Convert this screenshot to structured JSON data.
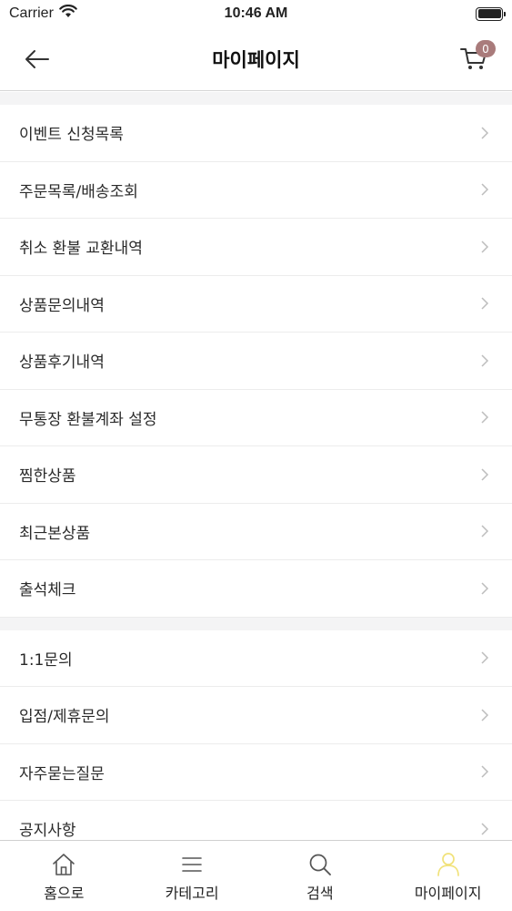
{
  "status_bar": {
    "carrier": "Carrier",
    "time": "10:46 AM"
  },
  "header": {
    "title": "마이페이지",
    "cart_count": "0"
  },
  "menu_sections": [
    {
      "items": [
        {
          "label": "이벤트 신청목록"
        },
        {
          "label": "주문목록/배송조회"
        },
        {
          "label": "취소 환불 교환내역"
        },
        {
          "label": "상품문의내역"
        },
        {
          "label": "상품후기내역"
        },
        {
          "label": "무통장 환불계좌 설정"
        },
        {
          "label": "찜한상품"
        },
        {
          "label": "최근본상품"
        },
        {
          "label": "출석체크"
        }
      ]
    },
    {
      "items": [
        {
          "label": "1:1문의"
        },
        {
          "label": "입점/제휴문의"
        },
        {
          "label": "자주묻는질문"
        },
        {
          "label": "공지사항"
        }
      ]
    }
  ],
  "tab_bar": {
    "tabs": [
      {
        "label": "홈으로",
        "icon": "home-icon"
      },
      {
        "label": "카테고리",
        "icon": "menu-icon"
      },
      {
        "label": "검색",
        "icon": "search-icon"
      },
      {
        "label": "마이페이지",
        "icon": "user-icon",
        "active": true
      }
    ]
  },
  "colors": {
    "badge": "#a97b7b",
    "active_tab_icon": "#f1e27a",
    "section_gap": "#f4f4f5"
  }
}
